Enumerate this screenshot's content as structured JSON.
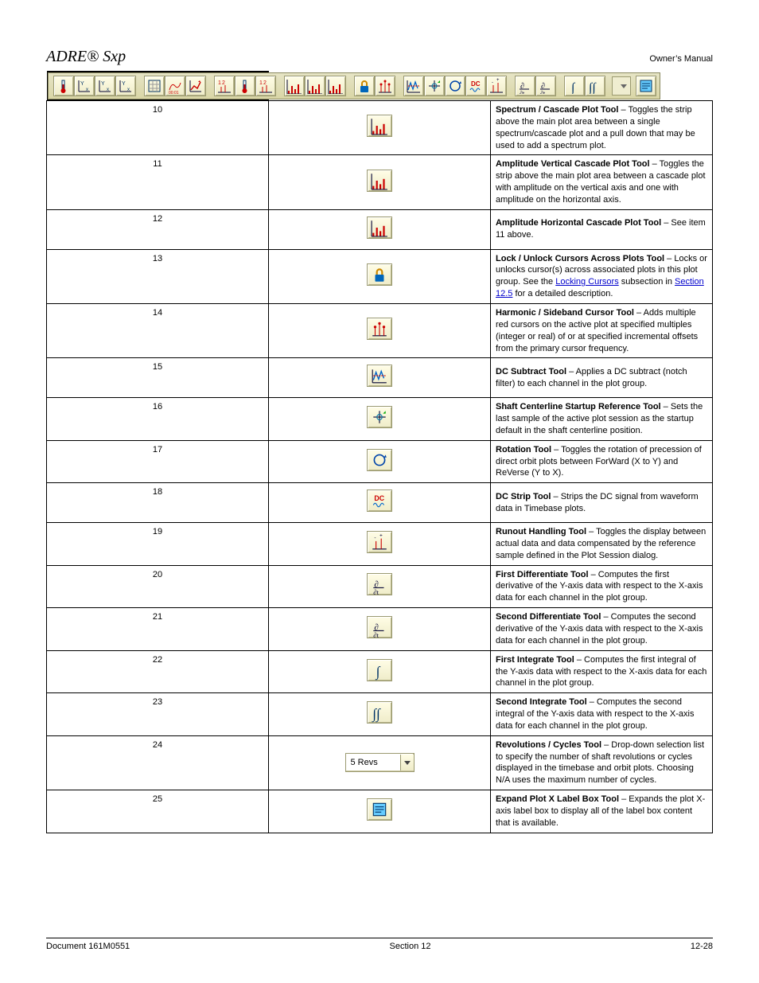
{
  "header": {
    "product": "ADRE® Sxp",
    "ownerLabel": "Owner’s Manual"
  },
  "toolbarDropdown": "<N/A>",
  "rows": [
    {
      "num": "10",
      "iconId": "spectrum-cascade",
      "title": "Spectrum / Cascade Plot Tool",
      "body": " – Toggles the strip above the main plot area between a single spectrum/cascade plot and a pull down that may be used to add a spectrum plot."
    },
    {
      "num": "11",
      "iconId": "amplitude-vertical",
      "title": "Amplitude Vertical Cascade Plot Tool",
      "body": " – Toggles the strip above the main plot area between a cascade plot with amplitude on the vertical axis and one with amplitude on the horizontal axis."
    },
    {
      "num": "12",
      "iconId": "amplitude-horizontal",
      "title": "Amplitude Horizontal Cascade Plot Tool",
      "body": " – See item 11 above."
    },
    {
      "num": "13",
      "iconId": "lock-unlock-cursors",
      "title": "Lock / Unlock Cursors Across Plots Tool",
      "body": " – Locks or unlocks cursor(s) across associated plots in this plot group.  See the ",
      "linkA": "Locking Cursors",
      "mid": " subsection in ",
      "linkB": "Section 12.5",
      "tail": " for a detailed description."
    },
    {
      "num": "14",
      "iconId": "harmonic-sideband",
      "title": "Harmonic / Sideband Cursor Tool",
      "body": " – Adds multiple red cursors on the active plot at specified multiples (integer or real) of or at specified incremental offsets from the primary cursor frequency."
    },
    {
      "num": "15",
      "iconId": "dc-subtract",
      "title": "DC Subtract Tool",
      "body": " – Applies a DC subtract (notch filter) to each channel in the plot group."
    },
    {
      "num": "16",
      "iconId": "shaft-centerline",
      "title": "Shaft Centerline Startup Reference Tool",
      "body": " – Sets the last sample of the active plot session as the startup default in the shaft centerline position."
    },
    {
      "num": "17",
      "iconId": "rotation",
      "title": "Rotation Tool",
      "body": " – Toggles the rotation of precession of direct orbit plots between ForWard (X to Y) and ReVerse (Y to X)."
    },
    {
      "num": "18",
      "iconId": "dc-strip",
      "title": "DC Strip Tool",
      "body": " – Strips the DC signal from waveform data in Timebase plots."
    },
    {
      "num": "19",
      "iconId": "runout-handling",
      "title": "Runout Handling Tool",
      "body": " – Toggles the display between actual data and data compensated by the reference sample defined in the Plot Session dialog."
    },
    {
      "num": "20",
      "iconId": "first-differentiate",
      "title": "First Differentiate Tool",
      "body": " – Computes the first derivative of the Y-axis data with respect to the X-axis data for each channel in the plot group."
    },
    {
      "num": "21",
      "iconId": "second-differentiate",
      "title": "Second Differentiate Tool",
      "body": " – Computes the second derivative of the Y-axis data with respect to the X-axis data for each channel in the plot group."
    },
    {
      "num": "22",
      "iconId": "first-integrate",
      "title": "First Integrate Tool",
      "body": " – Computes the first integral of the Y-axis data with respect to the X-axis data for each channel in the plot group."
    },
    {
      "num": "23",
      "iconId": "second-integrate",
      "title": "Second Integrate Tool",
      "body": " – Computes the second integral of the Y-axis data with respect to the X-axis data for each channel in the plot group."
    },
    {
      "num": "24",
      "iconId": "revolutions-cycles",
      "selectText": "5 Revs",
      "title": "Revolutions / Cycles Tool",
      "body": " – Drop-down selection list to specify the number of shaft revolutions or cycles displayed in the timebase and orbit plots.  Choosing N/A uses the maximum number of cycles."
    },
    {
      "num": "25",
      "iconId": "expand-label-box",
      "title": "Expand Plot X Label Box Tool",
      "body": " – Expands the plot X-axis label box to display all of the label box content that is available."
    }
  ],
  "toolbarButtons": [
    {
      "id": "tb-thermometer",
      "icon": "thermometer-icon",
      "ref": "svg-thermometer"
    },
    {
      "id": "tb-yminmax-a",
      "icon": "y-xrange-a-icon",
      "ref": "svg-xymin"
    },
    {
      "id": "tb-yminmax-b",
      "icon": "y-yrange-icon",
      "ref": "svg-xymin"
    },
    {
      "id": "tb-xrange",
      "icon": "x-range-icon",
      "ref": "svg-xymin"
    },
    {
      "id": "tb-grid",
      "icon": "grid-icon",
      "ref": "svg-grid"
    },
    {
      "id": "tb-time",
      "icon": "time-icon",
      "ref": "svg-clock"
    },
    {
      "id": "tb-trend",
      "icon": "trend-icon",
      "ref": "svg-trend"
    },
    {
      "id": "tb-axis-1p2",
      "icon": "axis-12-icon",
      "ref": "svg-12"
    },
    {
      "id": "tb-values",
      "icon": "values-icon",
      "ref": "svg-thermometer"
    },
    {
      "id": "tb-labels-123",
      "icon": "labels-123-icon",
      "ref": "svg-12"
    },
    {
      "id": "tb-spectrum",
      "icon": "spectrum-cascade-icon",
      "ref": "svg-spectrum"
    },
    {
      "id": "tb-amp-vert",
      "icon": "amplitude-vertical-icon",
      "ref": "svg-spectrum"
    },
    {
      "id": "tb-amp-horz",
      "icon": "amplitude-horizontal-icon",
      "ref": "svg-spectrum"
    },
    {
      "id": "tb-lock",
      "icon": "lock-icon",
      "ref": "svg-lock"
    },
    {
      "id": "tb-harmonic",
      "icon": "harmonic-sideband-icon",
      "ref": "svg-harmonic"
    },
    {
      "id": "tb-dcsub",
      "icon": "dc-subtract-icon",
      "ref": "svg-dcsub"
    },
    {
      "id": "tb-centerline",
      "icon": "shaft-centerline-icon",
      "ref": "svg-centerline"
    },
    {
      "id": "tb-rotation",
      "icon": "rotation-icon",
      "ref": "svg-rotation"
    },
    {
      "id": "tb-dcstrip",
      "icon": "dc-strip-icon",
      "ref": "svg-dcstrip"
    },
    {
      "id": "tb-runout",
      "icon": "runout-icon",
      "ref": "svg-runout"
    },
    {
      "id": "tb-d1",
      "icon": "first-derivative-icon",
      "ref": "svg-ddt"
    },
    {
      "id": "tb-d2",
      "icon": "second-derivative-icon",
      "ref": "svg-ddt"
    },
    {
      "id": "tb-i1",
      "icon": "first-integral-icon",
      "ref": "svg-int1"
    },
    {
      "id": "tb-i2",
      "icon": "second-integral-icon",
      "ref": "svg-int2"
    },
    {
      "id": "tb-expand",
      "icon": "expand-label-box-icon",
      "ref": "svg-expand"
    }
  ],
  "toolbarGroups": [
    [
      0,
      1,
      2,
      3
    ],
    [
      4,
      5,
      6
    ],
    [
      7,
      8,
      9
    ],
    [
      10,
      11,
      12
    ],
    [
      13,
      14
    ],
    [
      15,
      16,
      17,
      18,
      19
    ],
    [
      20,
      21
    ],
    [
      22,
      23
    ]
  ],
  "rowIconMap": {
    "spectrum-cascade": "svg-spectrum",
    "amplitude-vertical": "svg-spectrum",
    "amplitude-horizontal": "svg-spectrum",
    "lock-unlock-cursors": "svg-lock",
    "harmonic-sideband": "svg-harmonic",
    "dc-subtract": "svg-dcsub",
    "shaft-centerline": "svg-centerline",
    "rotation": "svg-rotation",
    "dc-strip": "svg-dcstrip",
    "runout-handling": "svg-runout",
    "first-differentiate": "svg-ddt",
    "second-differentiate": "svg-ddt",
    "first-integrate": "svg-int1",
    "second-integrate": "svg-int2",
    "expand-label-box": "svg-expand"
  },
  "footer": {
    "left": "Document 161M0551",
    "center": "Section 12",
    "page": "12-28"
  }
}
